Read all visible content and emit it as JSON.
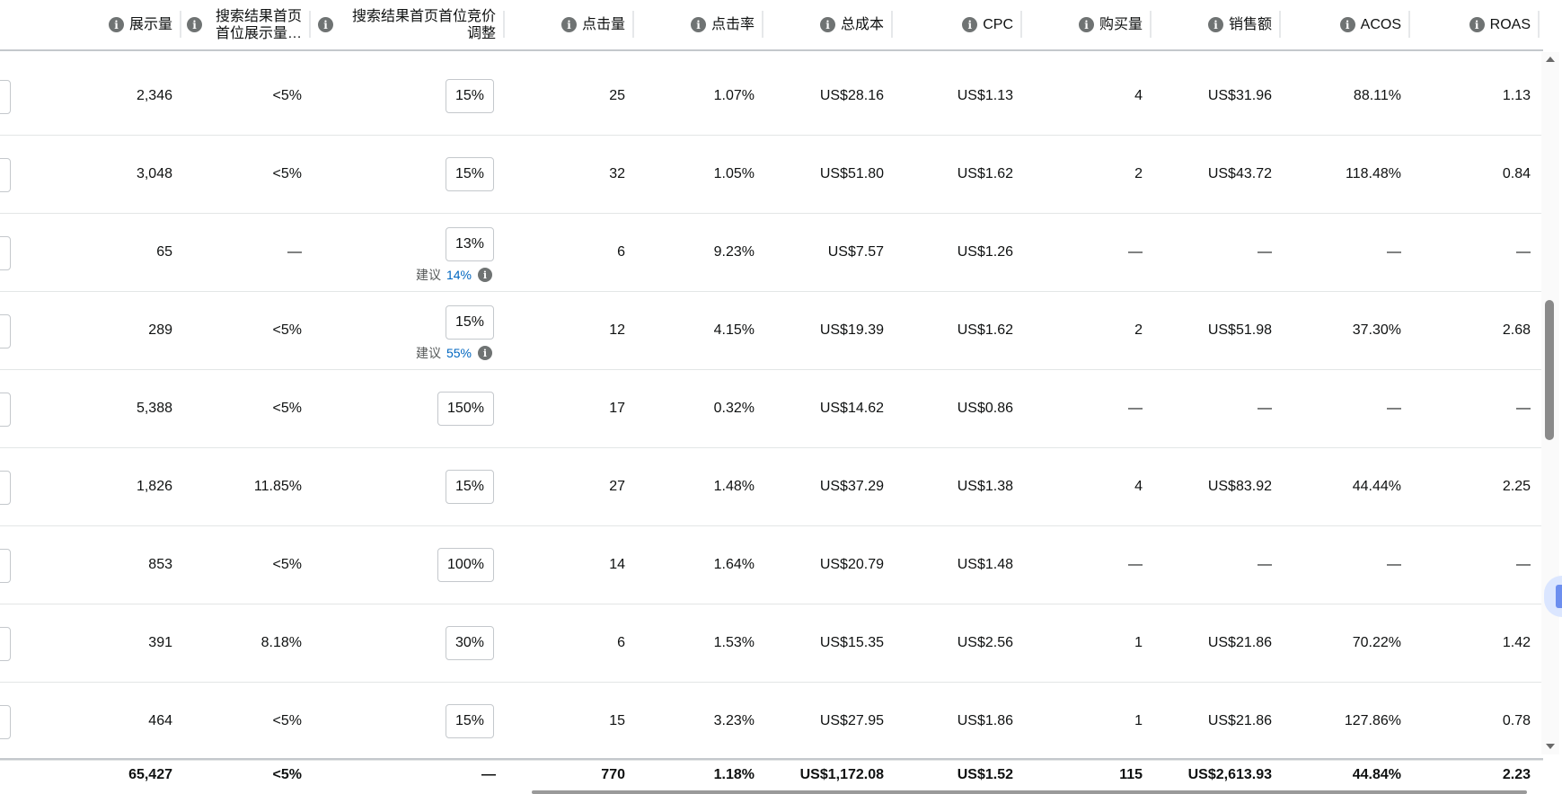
{
  "columns": [
    {
      "key": "impressions",
      "label": "展示量"
    },
    {
      "key": "tos_is",
      "label": "搜索结果首页首位展示量…"
    },
    {
      "key": "tos_bid_adj",
      "label": "搜索结果首页首位竞价调整"
    },
    {
      "key": "clicks",
      "label": "点击量"
    },
    {
      "key": "ctr",
      "label": "点击率"
    },
    {
      "key": "spend",
      "label": "总成本"
    },
    {
      "key": "cpc",
      "label": "CPC"
    },
    {
      "key": "orders",
      "label": "购买量"
    },
    {
      "key": "sales",
      "label": "销售额"
    },
    {
      "key": "acos",
      "label": "ACOS"
    },
    {
      "key": "roas",
      "label": "ROAS"
    }
  ],
  "suggestion_label": "建议",
  "rows": [
    {
      "impressions": "2,346",
      "tos_is": "<5%",
      "bid": "15%",
      "suggest": "",
      "clicks": "25",
      "ctr": "1.07%",
      "spend": "US$28.16",
      "cpc": "US$1.13",
      "orders": "4",
      "sales": "US$31.96",
      "acos": "88.11%",
      "roas": "1.13"
    },
    {
      "impressions": "3,048",
      "tos_is": "<5%",
      "bid": "15%",
      "suggest": "",
      "clicks": "32",
      "ctr": "1.05%",
      "spend": "US$51.80",
      "cpc": "US$1.62",
      "orders": "2",
      "sales": "US$43.72",
      "acos": "118.48%",
      "roas": "0.84"
    },
    {
      "impressions": "65",
      "tos_is": "—",
      "bid": "13%",
      "suggest": "14%",
      "clicks": "6",
      "ctr": "9.23%",
      "spend": "US$7.57",
      "cpc": "US$1.26",
      "orders": "—",
      "sales": "—",
      "acos": "—",
      "roas": "—"
    },
    {
      "impressions": "289",
      "tos_is": "<5%",
      "bid": "15%",
      "suggest": "55%",
      "clicks": "12",
      "ctr": "4.15%",
      "spend": "US$19.39",
      "cpc": "US$1.62",
      "orders": "2",
      "sales": "US$51.98",
      "acos": "37.30%",
      "roas": "2.68"
    },
    {
      "impressions": "5,388",
      "tos_is": "<5%",
      "bid": "150%",
      "suggest": "",
      "clicks": "17",
      "ctr": "0.32%",
      "spend": "US$14.62",
      "cpc": "US$0.86",
      "orders": "—",
      "sales": "—",
      "acos": "—",
      "roas": "—"
    },
    {
      "impressions": "1,826",
      "tos_is": "11.85%",
      "bid": "15%",
      "suggest": "",
      "clicks": "27",
      "ctr": "1.48%",
      "spend": "US$37.29",
      "cpc": "US$1.38",
      "orders": "4",
      "sales": "US$83.92",
      "acos": "44.44%",
      "roas": "2.25"
    },
    {
      "impressions": "853",
      "tos_is": "<5%",
      "bid": "100%",
      "suggest": "",
      "clicks": "14",
      "ctr": "1.64%",
      "spend": "US$20.79",
      "cpc": "US$1.48",
      "orders": "—",
      "sales": "—",
      "acos": "—",
      "roas": "—"
    },
    {
      "impressions": "391",
      "tos_is": "8.18%",
      "bid": "30%",
      "suggest": "",
      "clicks": "6",
      "ctr": "1.53%",
      "spend": "US$15.35",
      "cpc": "US$2.56",
      "orders": "1",
      "sales": "US$21.86",
      "acos": "70.22%",
      "roas": "1.42"
    },
    {
      "impressions": "464",
      "tos_is": "<5%",
      "bid": "15%",
      "suggest": "",
      "clicks": "15",
      "ctr": "3.23%",
      "spend": "US$27.95",
      "cpc": "US$1.86",
      "orders": "1",
      "sales": "US$21.86",
      "acos": "127.86%",
      "roas": "0.78"
    }
  ],
  "totals": {
    "impressions": "65,427",
    "tos_is": "<5%",
    "bid": "—",
    "clicks": "770",
    "ctr": "1.18%",
    "spend": "US$1,172.08",
    "cpc": "US$1.52",
    "orders": "115",
    "sales": "US$2,613.93",
    "acos": "44.84%",
    "roas": "2.23"
  },
  "icons": {
    "info": "info-icon",
    "scroll_up": "chevron-up-icon",
    "scroll_down": "chevron-down-icon"
  }
}
